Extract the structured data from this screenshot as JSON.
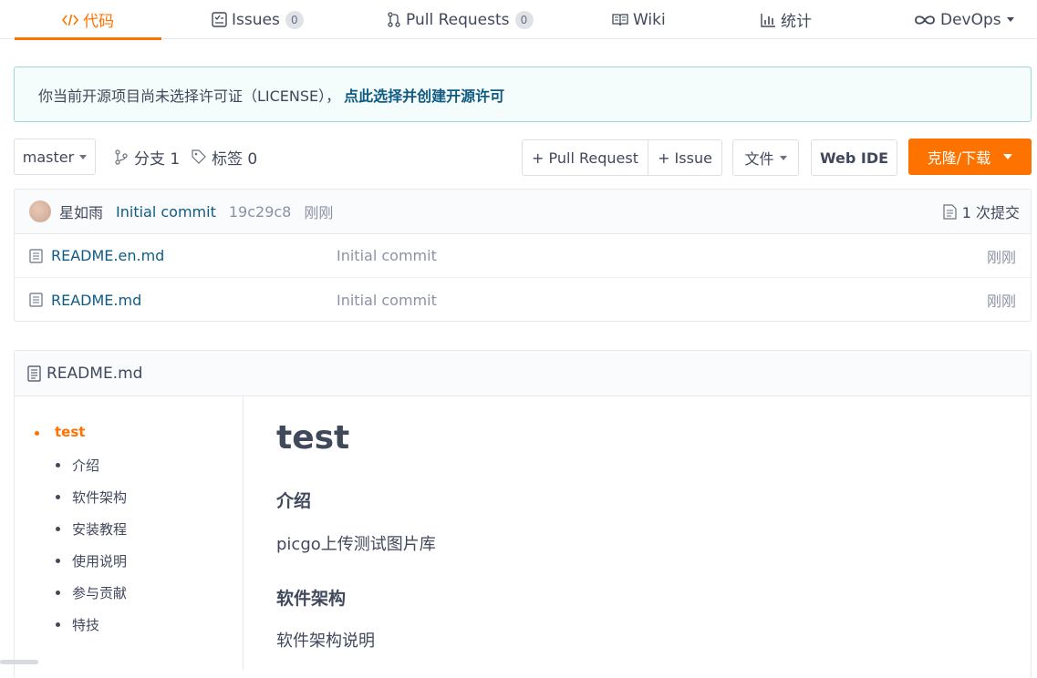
{
  "tabs": {
    "code": "代码",
    "issues": "Issues",
    "issues_count": "0",
    "pull_requests": "Pull Requests",
    "pull_requests_count": "0",
    "wiki": "Wiki",
    "stats": "统计",
    "devops": "DevOps"
  },
  "notice": {
    "text": "你当前开源项目尚未选择许可证（LICENSE），",
    "link": "点此选择并创建开源许可"
  },
  "toolbar": {
    "branch": "master",
    "branches": "分支 1",
    "tags": "标签 0",
    "pull_request": "+ Pull Request",
    "issue": "+ Issue",
    "file": "文件",
    "web_ide": "Web IDE",
    "clone": "克隆/下载"
  },
  "commit": {
    "author": "星如雨",
    "message": "Initial commit",
    "hash": "19c29c8",
    "time": "刚刚",
    "count": "1 次提交"
  },
  "files": [
    {
      "name": "README.en.md",
      "message": "Initial commit",
      "time": "刚刚"
    },
    {
      "name": "README.md",
      "message": "Initial commit",
      "time": "刚刚"
    }
  ],
  "readme": {
    "title": "README.md",
    "toc": [
      "test",
      "介绍",
      "软件架构",
      "安装教程",
      "使用说明",
      "参与贡献",
      "特技"
    ],
    "h1": "test",
    "sections": [
      {
        "heading": "介绍",
        "body": "picgo上传测试图片库"
      },
      {
        "heading": "软件架构",
        "body": "软件架构说明"
      }
    ]
  },
  "colors": {
    "accent": "#fe7300",
    "link": "#0f5b82",
    "notice_border": "#9fd7d6"
  }
}
